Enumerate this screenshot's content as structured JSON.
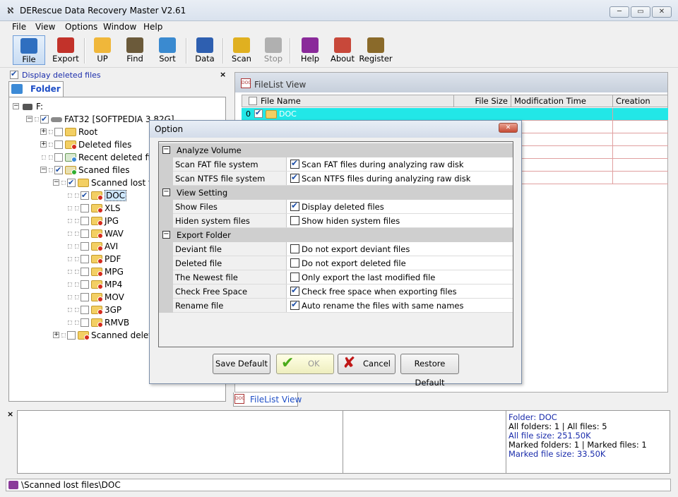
{
  "window": {
    "title": "DERescue Data Recovery Master V2.61",
    "controls": {
      "minimize": "─",
      "maximize": "▭",
      "close": "✕"
    }
  },
  "menu": [
    "File",
    "View",
    "Options",
    "Window",
    "Help"
  ],
  "toolbar": [
    {
      "label": "File",
      "icon": "file-icon",
      "color": "#2f6fc0"
    },
    {
      "label": "Export",
      "icon": "export-icon",
      "color": "#c2322a"
    },
    {
      "label": "UP",
      "icon": "up-folder-icon",
      "color": "#f0b73a"
    },
    {
      "label": "Find",
      "icon": "find-icon",
      "color": "#6b5a3a"
    },
    {
      "label": "Sort",
      "icon": "sort-icon",
      "color": "#3a8ad0"
    },
    {
      "label": "Data",
      "icon": "data-icon",
      "color": "#2e5fb0"
    },
    {
      "label": "Scan",
      "icon": "scan-icon",
      "color": "#e0b020"
    },
    {
      "label": "Stop",
      "icon": "stop-icon",
      "color": "#b0b0b0"
    },
    {
      "label": "Help",
      "icon": "help-icon",
      "color": "#8a2a9a"
    },
    {
      "label": "About",
      "icon": "about-icon",
      "color": "#c8483a"
    },
    {
      "label": "Register",
      "icon": "register-icon",
      "color": "#8a6a2a"
    }
  ],
  "left_pane": {
    "display_deleted_label": "Display deleted files",
    "close": "×",
    "tab": "Folder"
  },
  "tree": [
    {
      "label": "F:",
      "icon": "drive-icon"
    },
    {
      "label": "FAT32 [SOFTPEDIA 3.82G]",
      "icon": "disk-icon"
    },
    {
      "label": "Root",
      "icon": "folder-icon"
    },
    {
      "label": "Deleted files",
      "icon": "folder-deleted-icon"
    },
    {
      "label": "Recent deleted files",
      "icon": "folder-recent-icon"
    },
    {
      "label": "Scaned files",
      "icon": "folder-scanned-icon"
    },
    {
      "label": "Scanned lost files",
      "icon": "folder-icon"
    },
    {
      "label": "DOC",
      "icon": "folder-bad-icon"
    },
    {
      "label": "XLS",
      "icon": "folder-bad-icon"
    },
    {
      "label": "JPG",
      "icon": "folder-bad-icon"
    },
    {
      "label": "WAV",
      "icon": "folder-bad-icon"
    },
    {
      "label": "AVI",
      "icon": "folder-bad-icon"
    },
    {
      "label": "PDF",
      "icon": "folder-bad-icon"
    },
    {
      "label": "MPG",
      "icon": "folder-bad-icon"
    },
    {
      "label": "MP4",
      "icon": "folder-bad-icon"
    },
    {
      "label": "MOV",
      "icon": "folder-bad-icon"
    },
    {
      "label": "3GP",
      "icon": "folder-bad-icon"
    },
    {
      "label": "RMVB",
      "icon": "folder-bad-icon"
    },
    {
      "label": "Scanned deleted",
      "icon": "folder-bad-icon"
    }
  ],
  "filelist": {
    "title": "FileList View",
    "columns": [
      "File Name",
      "File Size",
      "Modification Time",
      "Creation Time"
    ],
    "first_row": {
      "index": "0",
      "name": "DOC"
    },
    "bottom_tab": "FileList View"
  },
  "status": {
    "folder": "Folder: DOC",
    "counts": "All folders: 1  | All files: 5",
    "size": " All file size: 251.50K",
    "marked": " Marked folders: 1  | Marked files: 1",
    "marked_size": "Marked file size: 33.50K",
    "close": "×",
    "path": "\\Scanned lost files\\DOC"
  },
  "dialog": {
    "title": "Option",
    "close": "✕",
    "sections": [
      {
        "title": "Analyze Volume",
        "rows": [
          {
            "name": "Scan FAT file system",
            "checked": true,
            "text": "Scan FAT files during analyzing raw disk"
          },
          {
            "name": "Scan NTFS file system",
            "checked": true,
            "text": "Scan NTFS files during analyzing raw disk"
          }
        ]
      },
      {
        "title": "View Setting",
        "rows": [
          {
            "name": "Show Files",
            "checked": true,
            "text": "Display deleted files"
          },
          {
            "name": "Hiden system files",
            "checked": false,
            "text": "Show hiden system files"
          }
        ]
      },
      {
        "title": "Export Folder",
        "rows": [
          {
            "name": "Deviant file",
            "checked": false,
            "text": "Do not export deviant files"
          },
          {
            "name": "Deleted file",
            "checked": false,
            "text": "Do not export deleted file"
          },
          {
            "name": "The Newest file",
            "checked": false,
            "text": "Only export the last modified file"
          },
          {
            "name": "Check Free Space",
            "checked": true,
            "text": "Check free space when exporting files"
          },
          {
            "name": "Rename file",
            "checked": true,
            "text": "Auto rename the files with same names"
          }
        ]
      }
    ],
    "buttons": {
      "save_default": "Save Default",
      "ok": "OK",
      "cancel": "Cancel",
      "restore_default": "Restore Default"
    }
  }
}
